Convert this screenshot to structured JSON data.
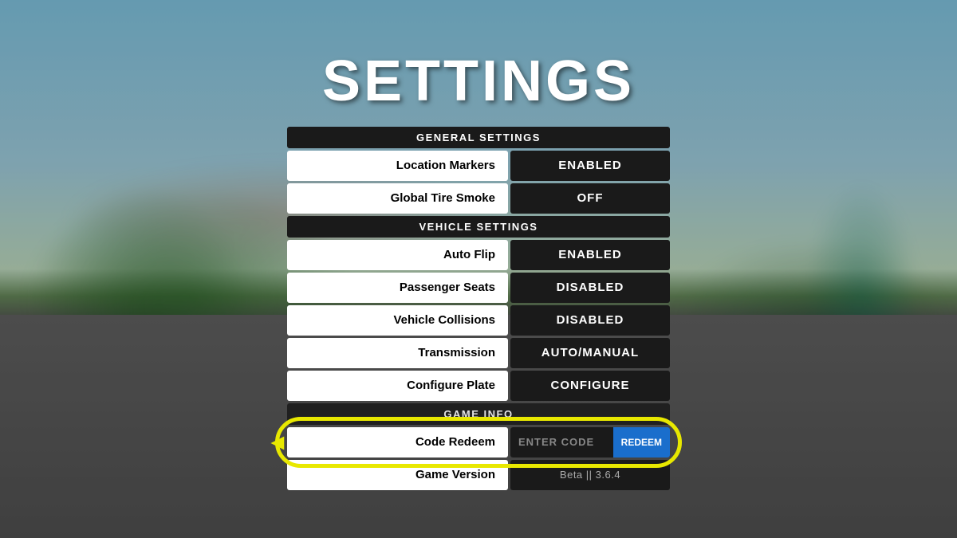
{
  "page": {
    "title": "SETTINGS",
    "background": {
      "sky_color": "#87CEEB",
      "road_color": "#555555"
    }
  },
  "sections": [
    {
      "id": "general",
      "header": "GENERAL SETTINGS",
      "rows": [
        {
          "id": "location-markers",
          "label": "Location Markers",
          "value": "ENABLED"
        },
        {
          "id": "global-tire-smoke",
          "label": "Global Tire Smoke",
          "value": "OFF"
        }
      ]
    },
    {
      "id": "vehicle",
      "header": "VEHICLE SETTINGS",
      "rows": [
        {
          "id": "auto-flip",
          "label": "Auto Flip",
          "value": "ENABLED"
        },
        {
          "id": "passenger-seats",
          "label": "Passenger Seats",
          "value": "DISABLED"
        },
        {
          "id": "vehicle-collisions",
          "label": "Vehicle Collisions",
          "value": "DISABLED"
        },
        {
          "id": "transmission",
          "label": "Transmission",
          "value": "AUTO/MANUAL"
        },
        {
          "id": "configure-plate",
          "label": "Configure Plate",
          "value": "CONFIGURE"
        }
      ]
    },
    {
      "id": "game-info",
      "header": "GAME INFO",
      "rows": [
        {
          "id": "code-redeem",
          "label": "Code Redeem",
          "value": "ENTER CODE",
          "type": "code",
          "btn_label": "REDEEM"
        },
        {
          "id": "game-version",
          "label": "Game Version",
          "value": "Beta || 3.6.4",
          "type": "version"
        }
      ]
    }
  ],
  "highlight": {
    "row_id": "code-redeem",
    "circle_color": "#e8e800",
    "arrow": "◄"
  }
}
